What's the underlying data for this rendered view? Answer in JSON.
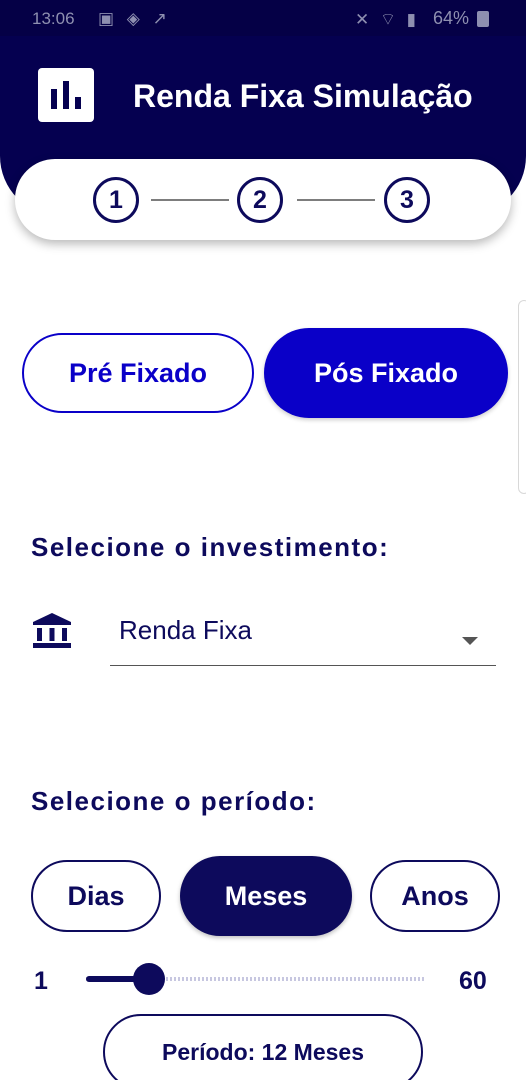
{
  "status_bar": {
    "time": "13:06",
    "notification_icons": "▣ ◈ ↗",
    "system_icons": "✕ ⌔ ▮",
    "battery": "64%"
  },
  "header": {
    "title": "Renda Fixa Simulação",
    "logo_icon": "bar-chart-icon",
    "background_color": "#050050"
  },
  "stepper": {
    "steps": [
      "1",
      "2",
      "3"
    ]
  },
  "rate_type": {
    "options": [
      "Pré Fixado",
      "Pós Fixado"
    ],
    "selected": "Pós Fixado",
    "accent_color": "#0a00c8"
  },
  "investment": {
    "label": "Selecione o investimento:",
    "icon": "bank-icon",
    "selected_value": "Renda Fixa"
  },
  "period": {
    "label": "Selecione o período:",
    "units": [
      "Dias",
      "Meses",
      "Anos"
    ],
    "selected_unit": "Meses",
    "slider_min": "1",
    "slider_max": "60",
    "slider_value": 12,
    "display": "Período: 12 Meses"
  }
}
